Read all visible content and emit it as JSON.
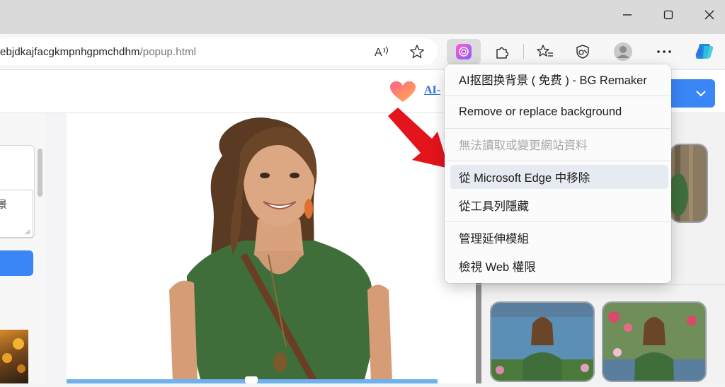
{
  "browser": {
    "url_host": "ebjdkajfacgkmpnhgpmchdhm",
    "url_path": "/popup.html",
    "toolbar_icons": [
      "read-aloud-icon",
      "favorite-star-icon",
      "extension-active-icon",
      "extensions-puzzle-icon",
      "favorites-list-icon",
      "browser-essentials-icon",
      "profile-avatar-icon",
      "more-menu-icon",
      "copilot-icon"
    ],
    "window_controls": [
      "minimize-icon",
      "maximize-icon",
      "close-icon"
    ]
  },
  "page": {
    "header_link": "AI-"
  },
  "context_menu": {
    "items": [
      {
        "label": "AI抠图换背景 ( 免费 ) - BG Remaker",
        "state": "normal"
      },
      {
        "label": "Remove or replace background",
        "state": "normal"
      },
      {
        "label": "無法讀取或變更網站資料",
        "state": "disabled"
      },
      {
        "label": "從 Microsoft Edge 中移除",
        "state": "hover"
      },
      {
        "label": "從工具列隱藏",
        "state": "normal"
      },
      {
        "label": "管理延伸模組",
        "state": "normal"
      },
      {
        "label": "檢視 Web 權限",
        "state": "normal"
      }
    ]
  },
  "colors": {
    "accent": "#3a86f6",
    "arrow": "#e3141b",
    "menu_hover": "#e6ebf1"
  }
}
